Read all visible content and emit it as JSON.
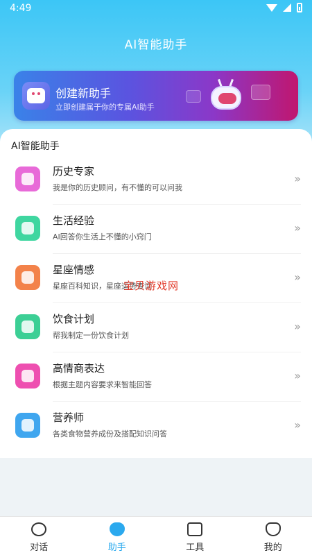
{
  "status_bar": {
    "time": "4:49"
  },
  "header": {
    "title": "AI智能助手"
  },
  "banner": {
    "title": "创建新助手",
    "subtitle": "立即创建属于你的专属AI助手"
  },
  "section": {
    "title": "AI智能助手"
  },
  "assistants": [
    {
      "title": "历史专家",
      "desc": "我是你的历史顾问，有不懂的可以问我",
      "icon": "history-book-icon",
      "color": "#e86ad8"
    },
    {
      "title": "生活经验",
      "desc": "AI回答你生活上不懂的小窍门",
      "icon": "calendar-tips-icon",
      "color": "#3fd6a0"
    },
    {
      "title": "星座情感",
      "desc": "星座百科知识，星座运势查询",
      "icon": "star-badge-icon",
      "color": "#f3824a"
    },
    {
      "title": "饮食计划",
      "desc": "帮我制定一份饮食计划",
      "icon": "chef-hat-icon",
      "color": "#3ccf95"
    },
    {
      "title": "高情商表达",
      "desc": "根据主题内容要求来智能回答",
      "icon": "chat-bubble-icon",
      "color": "#ee4fb0"
    },
    {
      "title": "营养师",
      "desc": "各类食物营养成份及搭配知识问答",
      "icon": "nutrition-box-icon",
      "color": "#3fa6ef"
    }
  ],
  "arrow_glyph": "»",
  "watermark": "宝贝游戏网",
  "tabbar": {
    "tabs": [
      {
        "label": "对话",
        "icon": "chat-icon"
      },
      {
        "label": "助手",
        "icon": "heart-icon",
        "active": true
      },
      {
        "label": "工具",
        "icon": "folder-icon"
      },
      {
        "label": "我的",
        "icon": "profile-icon"
      }
    ],
    "active_color": "#28a9ee"
  }
}
